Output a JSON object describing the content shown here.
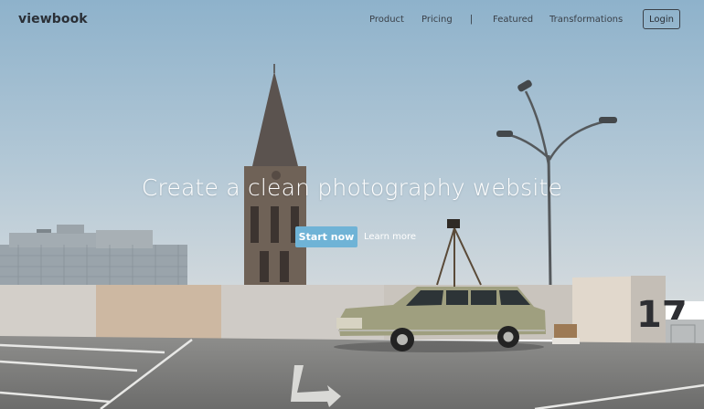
{
  "nav": {
    "logo": "viewbook",
    "links": [
      "Product",
      "Pricing",
      "Featured",
      "Transformations"
    ],
    "separator": "|",
    "login_label": "Login"
  },
  "hero": {
    "headline": "Create a clean photography website",
    "primary_cta": "Start now",
    "secondary_cta": "Learn more",
    "wall_number": "17"
  },
  "colors": {
    "accent": "#6fb3d6",
    "sky_top": "#8fb3cc",
    "sky_bottom": "#c9d6de"
  }
}
